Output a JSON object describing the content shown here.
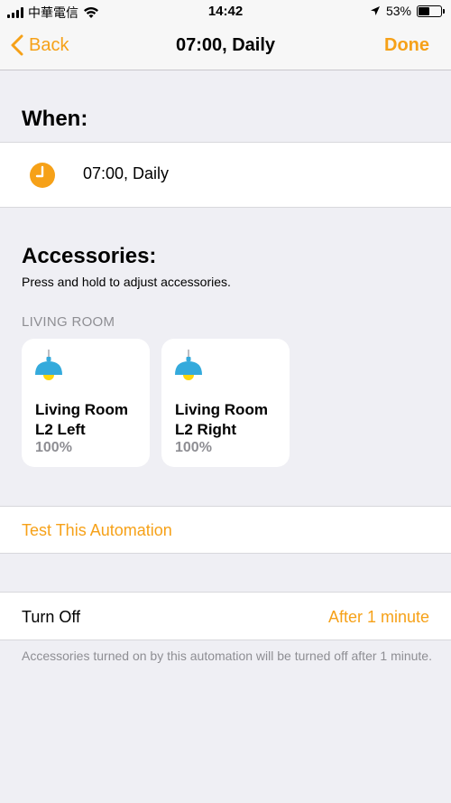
{
  "status_bar": {
    "carrier": "中華電信",
    "time": "14:42",
    "battery_pct": "53%",
    "battery_level": 0.53,
    "icons": [
      "signal-icon",
      "wifi-icon",
      "location-icon",
      "battery-icon"
    ]
  },
  "nav": {
    "back_label": "Back",
    "title": "07:00, Daily",
    "done_label": "Done"
  },
  "when": {
    "heading": "When:",
    "value": "07:00, Daily",
    "icon": "clock-icon"
  },
  "accessories": {
    "heading": "Accessories:",
    "subtitle": "Press and hold to adjust accessories.",
    "room": "LIVING ROOM",
    "tiles": [
      {
        "name_line1": "Living Room",
        "name_line2": "L2 Left",
        "level": "100%",
        "icon": "lamp-icon"
      },
      {
        "name_line1": "Living Room",
        "name_line2": "L2 Right",
        "level": "100%",
        "icon": "lamp-icon"
      }
    ]
  },
  "test": {
    "label": "Test This Automation"
  },
  "turn_off": {
    "label": "Turn Off",
    "value": "After 1 minute",
    "note": "Accessories turned on by this automation will be turned off after 1 minute."
  },
  "colors": {
    "accent": "#f6a118",
    "lamp_shade": "#34aadc",
    "lamp_bulb": "#ffd60a",
    "background": "#efeff4",
    "secondary_text": "#8e8e93"
  }
}
